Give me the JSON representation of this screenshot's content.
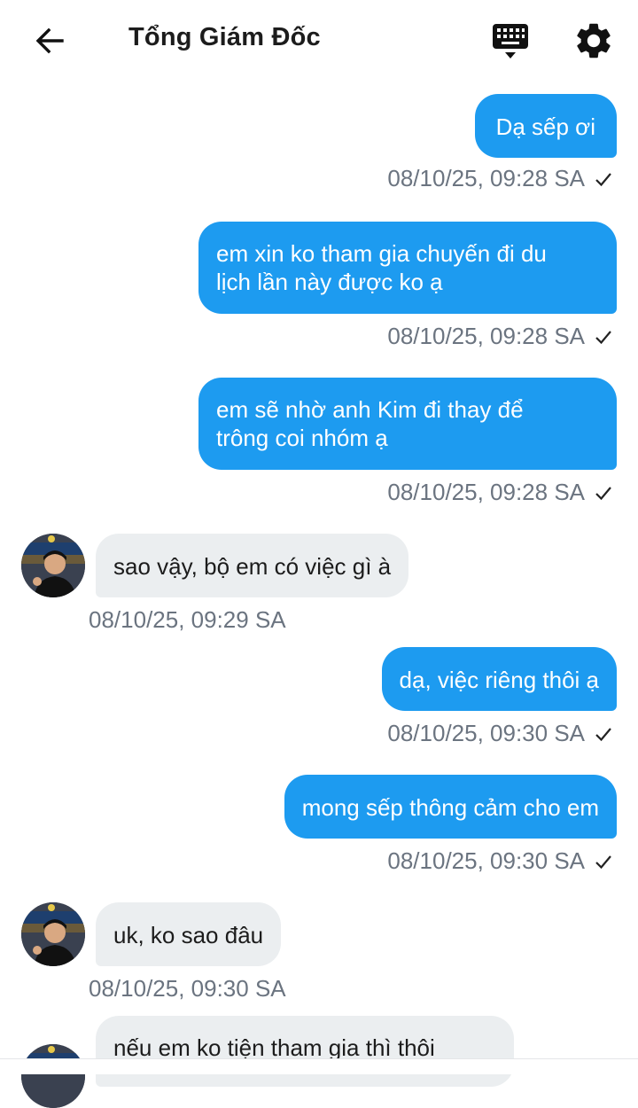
{
  "header": {
    "title": "Tổng Giám Đốc",
    "back_icon": "arrow-left-icon",
    "keyboard_icon": "keyboard-icon",
    "settings_icon": "gear-icon"
  },
  "colors": {
    "outgoing_bubble": "#1d9bf0",
    "incoming_bubble": "#ebeef0",
    "timestamp": "#6b7480"
  },
  "messages": [
    {
      "direction": "out",
      "text": "Dạ sếp ơi",
      "time": "08/10/25, 09:28 SA",
      "read_icon": "check-icon"
    },
    {
      "direction": "out",
      "lines": [
        "em xin ko tham gia chuyến đi du",
        "lịch lần này được ko ạ"
      ],
      "time": "08/10/25, 09:28 SA",
      "read_icon": "check-icon"
    },
    {
      "direction": "out",
      "lines": [
        "em sẽ nhờ anh Kim đi thay để",
        "trông coi nhóm ạ"
      ],
      "time": "08/10/25, 09:28 SA",
      "read_icon": "check-icon"
    },
    {
      "direction": "in",
      "text": "sao vậy, bộ em có việc gì à",
      "time": "08/10/25, 09:29 SA"
    },
    {
      "direction": "out",
      "text": "dạ, việc riêng thôi ạ",
      "time": "08/10/25, 09:30 SA",
      "read_icon": "check-icon"
    },
    {
      "direction": "out",
      "text": "mong sếp thông cảm cho em",
      "time": "08/10/25, 09:30 SA",
      "read_icon": "check-icon"
    },
    {
      "direction": "in",
      "text": "uk, ko sao đâu",
      "time": "08/10/25, 09:30 SA"
    },
    {
      "direction": "in",
      "text": "nếu em ko tiện tham gia thì thôi"
    }
  ]
}
